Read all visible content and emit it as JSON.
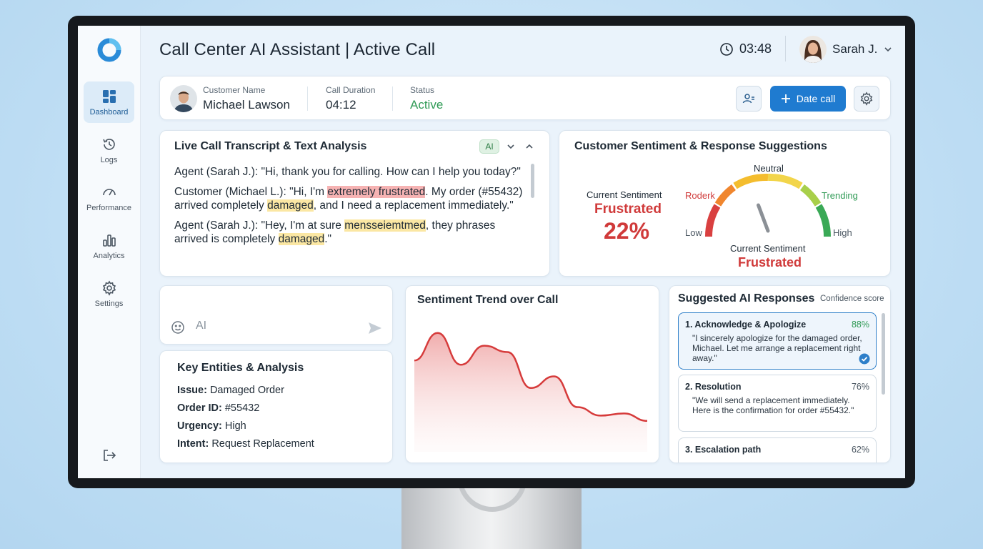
{
  "app": {
    "title": "Call Center AI Assistant | Active Call",
    "timer": "03:48",
    "user_name": "Sarah J."
  },
  "sidebar": {
    "items": [
      {
        "label": "Dashboard",
        "icon": "dashboard-icon",
        "active": true
      },
      {
        "label": "Logs",
        "icon": "history-icon"
      },
      {
        "label": "Performance",
        "icon": "speedometer-icon"
      },
      {
        "label": "Analytics",
        "icon": "bar-chart-icon"
      },
      {
        "label": "Settings",
        "icon": "gear-icon"
      }
    ],
    "logout_icon": "logout-icon"
  },
  "customer": {
    "name_label": "Customer Name",
    "name": "Michael Lawson",
    "duration_label": "Call Duration",
    "duration": "04:12",
    "status_label": "Status",
    "status": "Active",
    "action_button": "Date call"
  },
  "transcript": {
    "title": "Live Call Transcript & Text Analysis",
    "badge": "AI",
    "lines": {
      "l1": "Agent (Sarah J.): \"Hi, thank you for calling. How can I help you today?\"",
      "l2_a": "Customer (Michael L.): \"Hi, I'm ",
      "l2_h1": "extremely frustrated",
      "l2_b": ". My order (#55432) arrived completely ",
      "l2_h2": "damaged",
      "l2_c": ", and I need a replacement immediately.\"",
      "l3_a": "Agent (Sarah J.): \"Hey, I'm at sure ",
      "l3_h1": "mensseiemtmed",
      "l3_b": ", they phrases arrived is completely ",
      "l3_h2": "damaged",
      "l3_c": ".\""
    }
  },
  "sentiment": {
    "title": "Customer Sentiment & Response Suggestions",
    "current_label": "Current Sentiment",
    "current_value": "Frustrated",
    "percent": "22%",
    "gauge": {
      "labels": {
        "neutral": "Neutral",
        "left": "Roderk",
        "right": "Trending",
        "low": "Low",
        "high": "High"
      },
      "needle_value": 0.22,
      "caption_label": "Current Sentiment",
      "caption_value": "Frustrated"
    }
  },
  "chat": {
    "placeholder": "AI"
  },
  "entities": {
    "title": "Key Entities & Analysis",
    "rows": [
      {
        "key": "Issue:",
        "value": " Damaged Order"
      },
      {
        "key": "Order ID:",
        "value": " #55432"
      },
      {
        "key": "Urgency:",
        "value": " High"
      },
      {
        "key": "Intent:",
        "value": " Request Replacement"
      }
    ]
  },
  "trend": {
    "title": "Sentiment Trend over Call"
  },
  "chart_data": {
    "type": "area",
    "title": "Sentiment Trend over Call",
    "x": [
      0,
      1,
      2,
      3,
      4,
      5,
      6,
      7,
      8,
      9,
      10
    ],
    "y": [
      0.62,
      0.88,
      0.58,
      0.76,
      0.7,
      0.36,
      0.47,
      0.18,
      0.1,
      0.12,
      0.05
    ],
    "ylim": [
      0,
      1
    ],
    "grid": false,
    "color": "#d63b3b"
  },
  "suggestions": {
    "title": "Suggested AI Responses",
    "confidence_label": "Confidence score",
    "items": [
      {
        "title": "1. Acknowledge & Apologize",
        "score": "88%",
        "text": "\"I sincerely apologize for the damaged order, Michael. Let me arrange a replacement right away.\"",
        "selected": true
      },
      {
        "title": "2. Resolution",
        "score": "76%",
        "text": "\"We will send a replacement immediately. Here is the confirmation for order #55432.\""
      },
      {
        "title": "3. Escalation path",
        "score": "62%",
        "text": ""
      }
    ]
  },
  "colors": {
    "accent": "#1f7bd0",
    "positive": "#2f9a55",
    "negative": "#d03a3a"
  }
}
